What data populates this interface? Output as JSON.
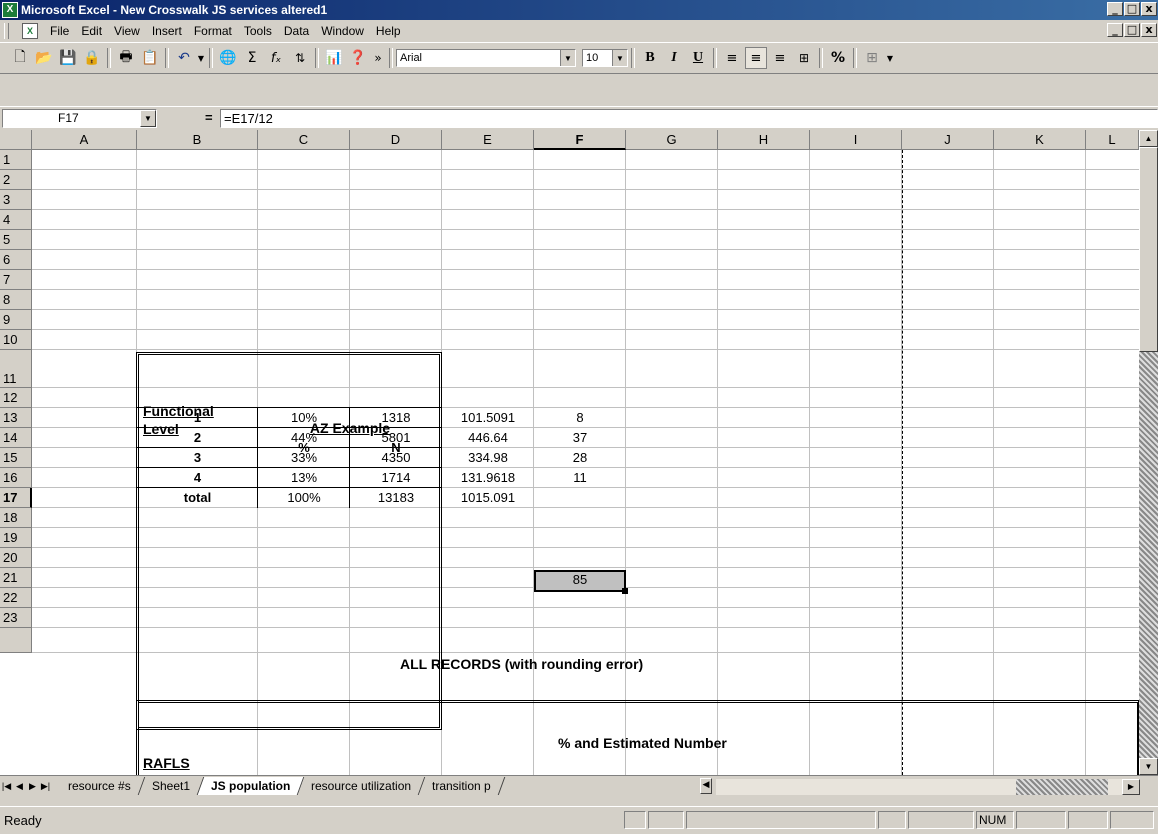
{
  "window": {
    "title": "Microsoft Excel - New Crosswalk JS services altered1",
    "controls": [
      "_",
      "□",
      "x"
    ]
  },
  "menu": [
    "File",
    "Edit",
    "View",
    "Insert",
    "Format",
    "Tools",
    "Data",
    "Window",
    "Help"
  ],
  "toolbar": {
    "font": "Arial",
    "size": "10",
    "bold": "B",
    "italic": "I",
    "underline": "U",
    "percent": "%",
    "sum": "Σ",
    "fx": "fₓ",
    "more": "»"
  },
  "formula_bar": {
    "name_box": "F17",
    "equals": "=",
    "formula": "=E17/12"
  },
  "columns": [
    "A",
    "B",
    "C",
    "D",
    "E",
    "F",
    "G",
    "H",
    "I",
    "J",
    "K",
    "L"
  ],
  "rows": [
    "1",
    "2",
    "3",
    "4",
    "5",
    "6",
    "7",
    "8",
    "9",
    "10",
    "11",
    "12",
    "13",
    "14",
    "15",
    "16",
    "17",
    "18",
    "19",
    "20",
    "21",
    "22",
    "23",
    ""
  ],
  "cells": {
    "b11_line1": "Functional",
    "b11_line2": "Level",
    "c11": "AZ Example",
    "c12": "%",
    "d12": "N",
    "table": [
      {
        "b": "1",
        "c": "10%",
        "d": "1318",
        "e": "101.5091",
        "f": "8"
      },
      {
        "b": "2",
        "c": "44%",
        "d": "5801",
        "e": "446.64",
        "f": "37"
      },
      {
        "b": "3",
        "c": "33%",
        "d": "4350",
        "e": "334.98",
        "f": "28"
      },
      {
        "b": "4",
        "c": "13%",
        "d": "1714",
        "e": "131.9618",
        "f": "11"
      },
      {
        "b": "total",
        "c": "100%",
        "d": "13183",
        "e": "1015.091",
        "f": "85"
      }
    ],
    "row20": "ALL RECORDS (with rounding error)",
    "row23": "% and Estimated Number",
    "row24": "RAFLS"
  },
  "sheet_tabs": [
    "resource #s",
    "Sheet1",
    "JS population",
    "resource utilization",
    "transition p"
  ],
  "active_tab": "JS population",
  "status": {
    "text": "Ready",
    "num": "NUM"
  },
  "colors": {
    "title_bar": "#0a246a",
    "chrome": "#d4d0c8",
    "selected_cell": "#c0c0c0"
  }
}
